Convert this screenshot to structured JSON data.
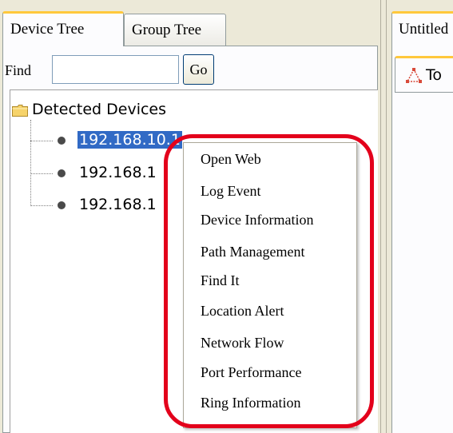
{
  "tabs": {
    "device_tree": "Device Tree",
    "group_tree": "Group Tree"
  },
  "find": {
    "label": "Find",
    "value": "",
    "placeholder": "",
    "go_label": "Go"
  },
  "tree": {
    "root_label": "Detected Devices",
    "nodes": [
      {
        "label": "192.168.10.1",
        "selected": true
      },
      {
        "label": "192.168.1",
        "selected": false
      },
      {
        "label": "192.168.1",
        "selected": false
      }
    ]
  },
  "right": {
    "tab_label": "Untitled",
    "subtab_label": "To"
  },
  "context_menu": {
    "items": [
      "Open Web",
      "Log Event",
      "Device Information",
      "Path Management",
      "Find It",
      "Location Alert",
      "Network Flow",
      "Port Performance",
      "Ring Information"
    ]
  },
  "colors": {
    "selection": "#316ac5",
    "tab_accent": "#ffc83c",
    "highlight_ring": "#e3001b"
  },
  "icons": {
    "folder": "folder-icon",
    "node": "device-node-icon",
    "topology": "topology-icon"
  }
}
